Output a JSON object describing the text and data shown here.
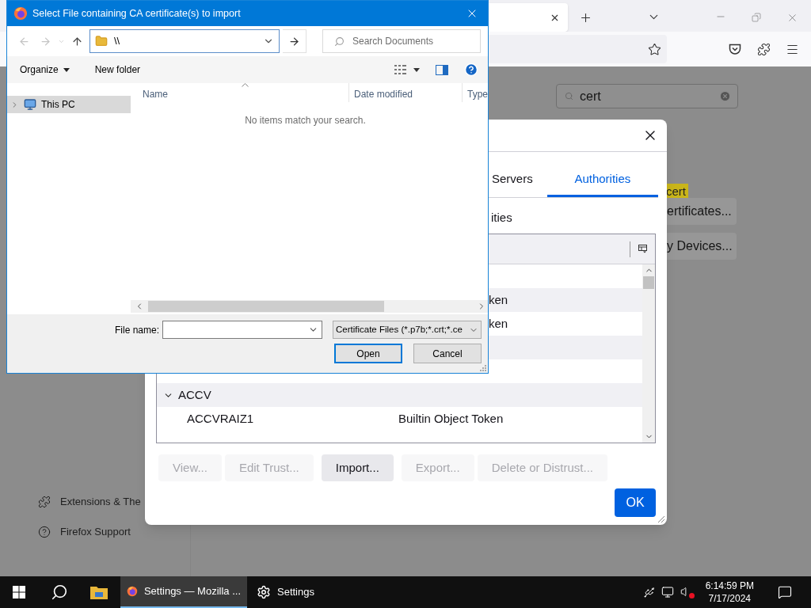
{
  "file_dialog": {
    "title": "Select File containing CA certificate(s) to import",
    "address": {
      "value": "\\\\"
    },
    "search": {
      "placeholder": "Search Documents"
    },
    "toolbar": [
      {
        "label": "Organize",
        "menu": true
      },
      {
        "label": "New folder",
        "menu": false
      }
    ],
    "nav": [
      {
        "label": "This PC",
        "selected": true,
        "expanded": false
      }
    ],
    "columns": [
      "Name",
      "Date modified",
      "Type"
    ],
    "empty_message": "No items match your search.",
    "file_name": {
      "label": "File name:"
    },
    "filter": "Certificate Files (*.p7b;*.crt;*.ce",
    "buttons": [
      {
        "label": "Open",
        "default": true
      },
      {
        "label": "Cancel",
        "default": false
      }
    ]
  },
  "browser": {
    "search": {
      "value": "cert"
    },
    "highlight": "cert",
    "buttons": [
      "ertificates...",
      "y Devices..."
    ],
    "sidebar": [
      {
        "kind": "extensions",
        "label": "Extensions & The"
      },
      {
        "kind": "support",
        "label": "Firefox Support"
      }
    ]
  },
  "cert_manager": {
    "tabs": [
      {
        "label": "Servers",
        "selected": false
      },
      {
        "label": "Authorities",
        "selected": true
      }
    ],
    "heading": "ities",
    "rows": [
      {
        "kind": "covered"
      },
      {
        "kind": "partial",
        "text": "ken"
      },
      {
        "kind": "partial",
        "text": "ken"
      },
      {
        "kind": "covered"
      },
      {
        "kind": "covered"
      },
      {
        "kind": "group",
        "name": "ACCV",
        "expanded": true
      },
      {
        "kind": "cert",
        "name": "ACCVRAIZ1",
        "token": "Builtin Object Token"
      }
    ],
    "buttons": [
      {
        "label": "View...",
        "disabled": true
      },
      {
        "label": "Edit Trust...",
        "disabled": true
      },
      {
        "label": "Import...",
        "disabled": false
      },
      {
        "label": "Export...",
        "disabled": true
      },
      {
        "label": "Delete or Distrust...",
        "disabled": true
      }
    ],
    "ok": "OK"
  },
  "taskbar": {
    "apps": [
      {
        "kind": "firefox",
        "label": "Settings — Mozilla ...",
        "active": true
      },
      {
        "kind": "settings",
        "label": "Settings",
        "active": false
      }
    ],
    "time": "6:14:59 PM",
    "date": "7/17/2024"
  }
}
